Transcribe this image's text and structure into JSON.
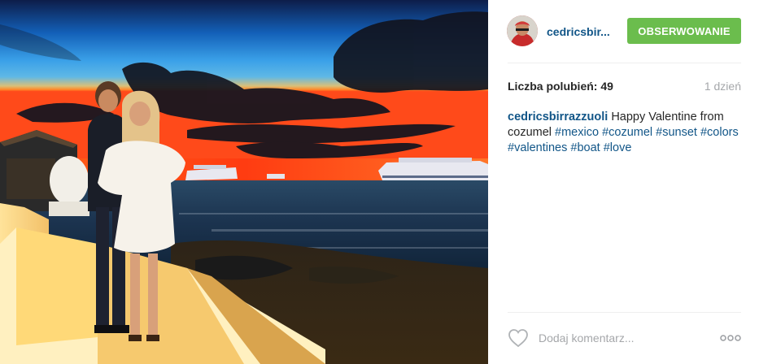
{
  "post": {
    "username": "cedricsbir...",
    "follow_label": "OBSERWOWANIE",
    "likes_text": "Liczba polubień: 49",
    "time_text": "1 dzień",
    "caption": {
      "user": "cedricsbirrazzuoli",
      "text_1": " Happy Valentine from cozumel ",
      "hashtags": [
        "#mexico",
        "#cozumel",
        "#sunset",
        "#colors",
        "#valentines",
        "#boat",
        "#love"
      ]
    },
    "comment": {
      "placeholder": "Dodaj komentarz..."
    }
  },
  "icons": {
    "like": "heart-outline-icon",
    "more": "more-options-icon"
  },
  "colors": {
    "follow_button": "#6bbd4d",
    "link": "#125688",
    "muted": "#a5a7aa"
  }
}
